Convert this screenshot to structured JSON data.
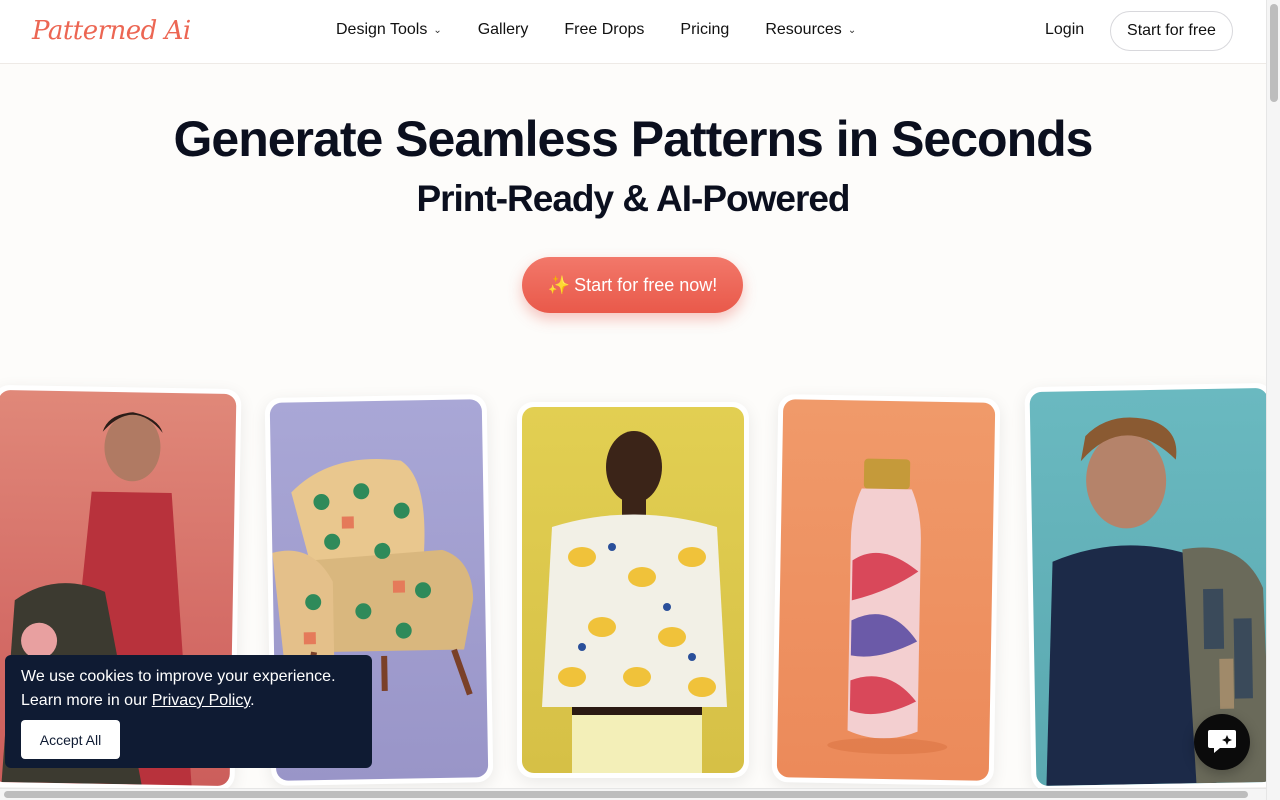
{
  "header": {
    "logo": "Patterned Ai",
    "nav": [
      {
        "label": "Design Tools",
        "dropdown": true
      },
      {
        "label": "Gallery",
        "dropdown": false
      },
      {
        "label": "Free Drops",
        "dropdown": false
      },
      {
        "label": "Pricing",
        "dropdown": false
      },
      {
        "label": "Resources",
        "dropdown": true
      }
    ],
    "login": "Login",
    "start": "Start for free"
  },
  "hero": {
    "title": "Generate Seamless Patterns in Seconds",
    "subtitle": "Print-Ready & AI-Powered",
    "cta": "Start for free now!",
    "cta_icon": "sparkles-icon"
  },
  "cards": [
    {
      "subject": "woman-with-floral-bag",
      "bg": "#d46c66"
    },
    {
      "subject": "palm-pattern-armchair",
      "bg": "#9995c8"
    },
    {
      "subject": "man-in-lemon-shirt",
      "bg": "#d6c046"
    },
    {
      "subject": "marble-water-bottle",
      "bg": "#ec8a5a"
    },
    {
      "subject": "boy-with-backpack",
      "bg": "#5aa8b0"
    }
  ],
  "cookie": {
    "line1": "We use cookies to improve your experience.",
    "line2_prefix": "Learn more in our ",
    "link": "Privacy Policy",
    "line2_suffix": ".",
    "accept": "Accept All"
  },
  "colors": {
    "brand": "#ec6653",
    "dark": "#0b0f1e",
    "cookie_bg": "#0f1b33"
  }
}
